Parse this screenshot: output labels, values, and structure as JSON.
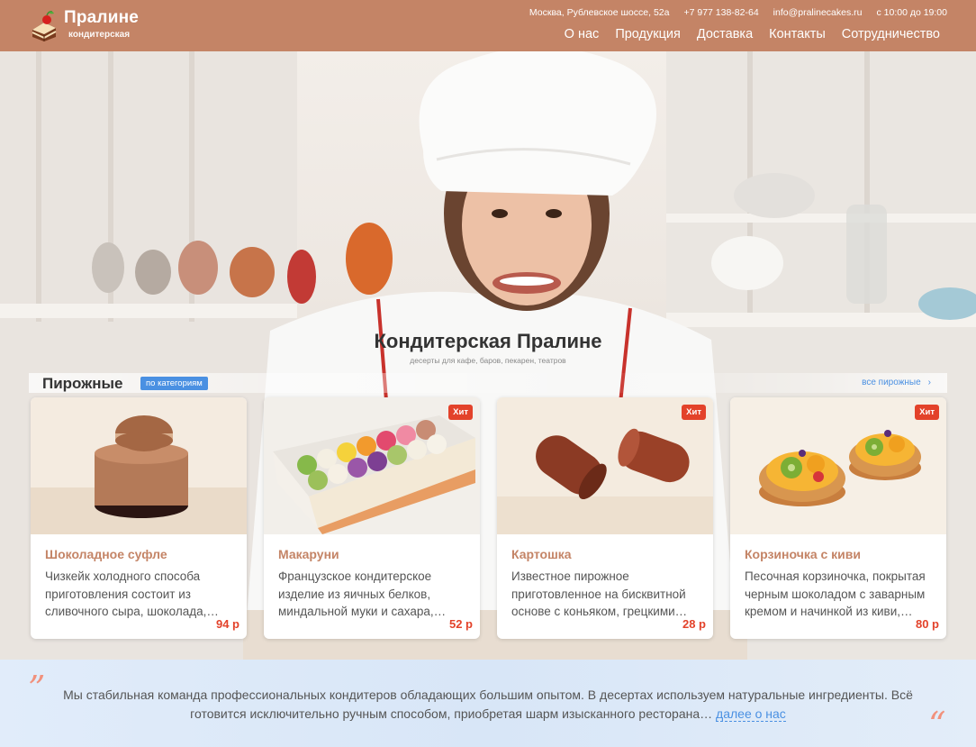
{
  "header": {
    "logo_title": "Пралине",
    "logo_sub": "кондитерская",
    "address": "Москва, Рублевское шоссе, 52а",
    "phone": "+7 977 138-82-64",
    "email": "info@pralinecakes.ru",
    "hours": "с 10:00 до 19:00",
    "nav": [
      "О нас",
      "Продукция",
      "Доставка",
      "Контакты",
      "Сотрудничество"
    ]
  },
  "hero": {
    "title": "Кондитерская Пралине",
    "subtitle": "десерты для кафе, баров, пекарен, театров"
  },
  "section": {
    "title": "Пирожные",
    "category_badge": "по категориям",
    "all_link": "все пирожные",
    "all_arrow": "›"
  },
  "products": [
    {
      "name": "Шоколадное суфле",
      "desc": "Чизкейк холодного способа приготовления состоит из сливочного сыра, шоколада,…",
      "price": "94 р",
      "badge": ""
    },
    {
      "name": "Макаруни",
      "desc": "Французское кондитерское изделие из яичных белков, миндальной муки и сахара,…",
      "price": "52 р",
      "badge": "Хит"
    },
    {
      "name": "Картошка",
      "desc": "Известное пирожное приготовленное на бисквитной основе с коньяком, грецкими…",
      "price": "28 р",
      "badge": "Хит"
    },
    {
      "name": "Корзиночка с киви",
      "desc": "Песочная корзиночка, покрытая черным шоколадом с заварным кремом и начинкой из киви,…",
      "price": "80 р",
      "badge": "Хит"
    }
  ],
  "footer": {
    "quote_open": "”",
    "quote_close": "“",
    "text": "Мы стабильная команда профессиональных кондитеров обладающих большим опытом. В десертах используем натуральные ингредиенты. Всё готовится исключительно ручным способом, приобретая шарм изысканного ресторана…",
    "more": "далее о нас"
  },
  "colors": {
    "brand": "#c48466",
    "accent": "#e3422a",
    "link": "#4a90e2"
  }
}
